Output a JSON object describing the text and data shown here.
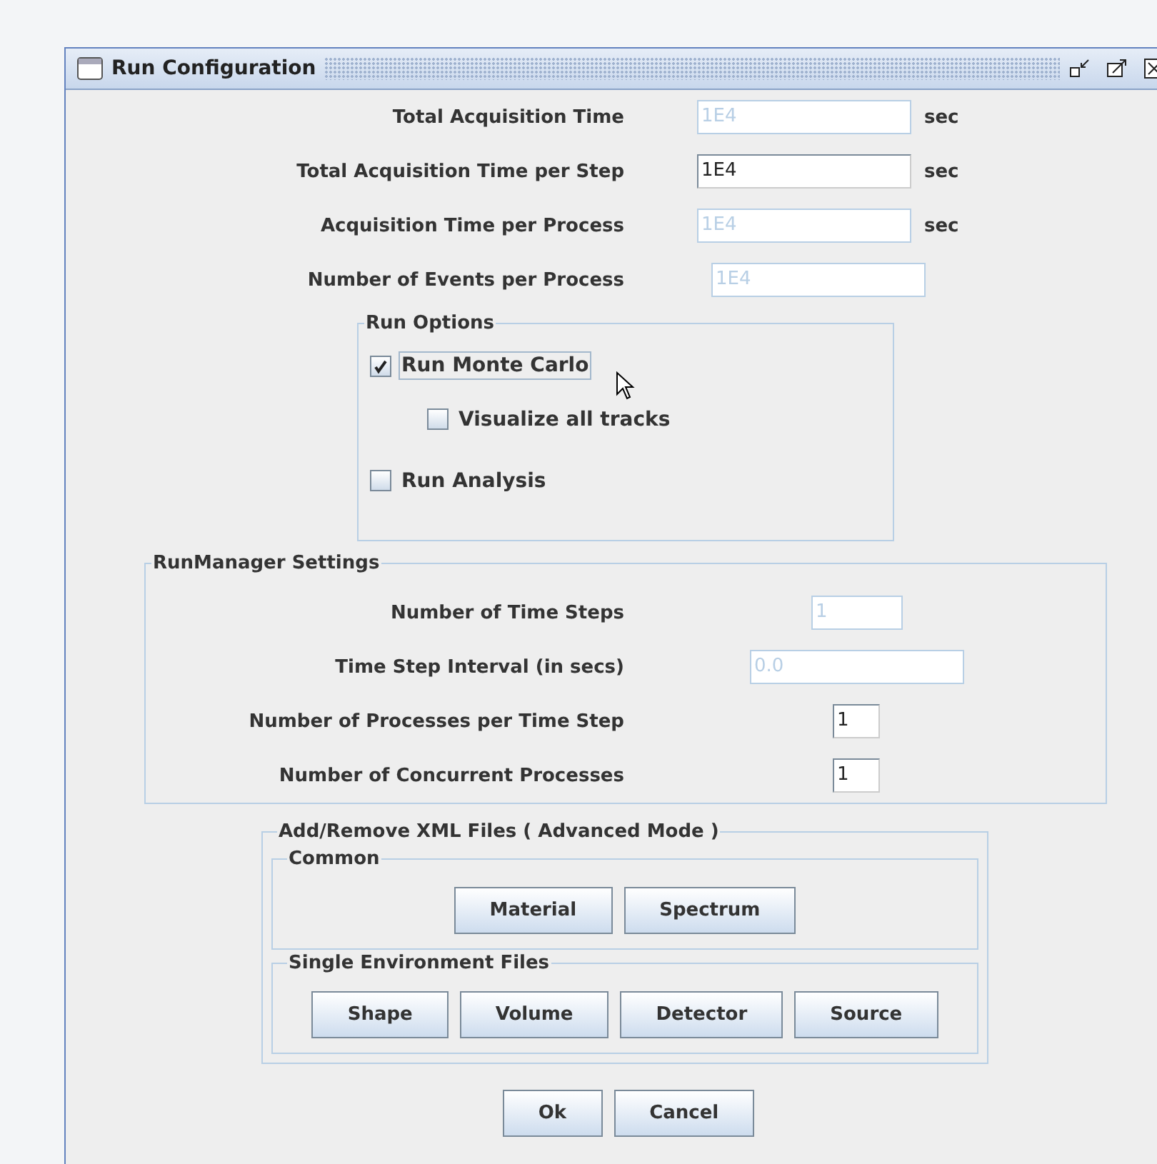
{
  "window": {
    "title": "Run Configuration"
  },
  "acquisition_fields": [
    {
      "label": "Total Acquisition Time",
      "value": "1E4",
      "unit": "sec",
      "disabled": true
    },
    {
      "label": "Total Acquisition Time per Step",
      "value": "1E4",
      "unit": "sec",
      "disabled": false
    },
    {
      "label": "Acquisition Time per Process",
      "value": "1E4",
      "unit": "sec",
      "disabled": true
    },
    {
      "label": "Number of Events per Process",
      "value": "1E4",
      "disabled": true
    }
  ],
  "run_options": {
    "title": "Run Options",
    "options": [
      {
        "label": "Run Monte Carlo",
        "checked": true,
        "focused": true,
        "children": [
          {
            "label": "Visualize all tracks",
            "checked": false,
            "focused": false
          }
        ]
      },
      {
        "label": "Run Analysis",
        "checked": false,
        "focused": false
      }
    ]
  },
  "run_manager": {
    "title": "RunManager Settings",
    "fields": [
      {
        "label": "Number of Time Steps",
        "value": "1",
        "disabled": true
      },
      {
        "label": "Time Step Interval (in secs)",
        "value": "0.0",
        "disabled": true
      },
      {
        "label": "Number of Processes per Time Step",
        "value": "1",
        "disabled": false
      },
      {
        "label": "Number of Concurrent Processes",
        "value": "1",
        "disabled": false
      }
    ]
  },
  "xml_files": {
    "title": "Add/Remove XML Files ( Advanced Mode )",
    "groups": [
      {
        "title": "Common",
        "buttons": [
          "Material",
          "Spectrum"
        ]
      },
      {
        "title": "Single Environment Files",
        "buttons": [
          "Shape",
          "Volume",
          "Detector",
          "Source"
        ]
      }
    ]
  },
  "buttons": [
    "Ok",
    "Cancel"
  ]
}
